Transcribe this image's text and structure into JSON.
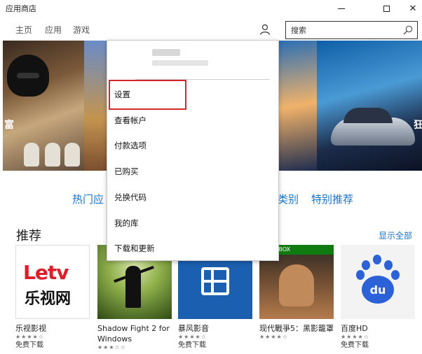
{
  "window": {
    "title": "应用商店"
  },
  "nav": {
    "home": "主页",
    "apps": "应用",
    "games": "游戏",
    "search_placeholder": "搜索"
  },
  "hero": {
    "left_char": "富",
    "right_char": "狂"
  },
  "categories": {
    "hot": "热门应",
    "kinds": "类别",
    "special": "特别推荐"
  },
  "section": {
    "title": "推荐",
    "show_all": "显示全部"
  },
  "apps": [
    {
      "name": "乐视影视",
      "rating_text": "★★★★☆",
      "rating": 4,
      "price": "免费下载"
    },
    {
      "name": "Shadow Fight 2 for Windows",
      "rating_text": "★★★☆☆",
      "rating": 3,
      "price": ""
    },
    {
      "name": "暴风影音",
      "rating_text": "★★★★☆",
      "rating": 4,
      "price": "免费下载"
    },
    {
      "name": "现代戰爭5：黑影籠罩",
      "rating_text": "★★★★☆",
      "rating": 4,
      "price": ""
    },
    {
      "name": "百度HD",
      "rating_text": "★★★★☆",
      "rating": 4,
      "price": "免费下载"
    }
  ],
  "tiles": {
    "letv_top": "Letv",
    "letv_bottom": "乐视网",
    "xbox_badge": "XBOX",
    "baidu_logo": "du"
  },
  "menu": {
    "items": [
      "设置",
      "查看帐户",
      "付款选项",
      "已购买",
      "兑换代码",
      "我的库",
      "下载和更新"
    ],
    "highlighted": "设置"
  },
  "colors": {
    "accent": "#1a73c7",
    "highlight_border": "#d6262d",
    "xbox_green": "#107c10"
  }
}
